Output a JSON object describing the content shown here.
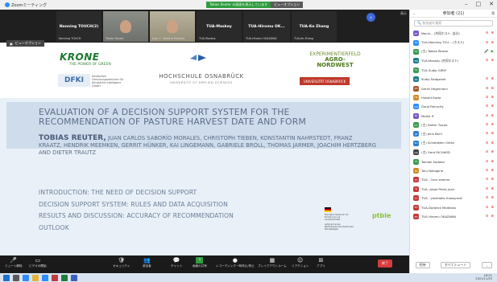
{
  "titlebar": {
    "app_title": "Zoomミーティング",
    "share_banner_green": "Tobias Reuter の画面を表示しています",
    "share_banner_gray": "ビューオプション"
  },
  "gallery": {
    "tiles": [
      {
        "name": "Nanning TOUCH(2)",
        "sub": "Nanning TOUCH"
      },
      {
        "name": "",
        "sub": "Tobias Reuter"
      },
      {
        "name": "",
        "sub": "Juan C. Saborío Morales"
      },
      {
        "name": "TUA-Maskey",
        "sub": "TUA-Maskey"
      },
      {
        "name": "TUA-Hiromu OK...",
        "sub": "TUA-Hiromu OKAZAWA"
      },
      {
        "name": "TUA-Ke Zhang",
        "sub": "TUA-Ke Zhang"
      }
    ],
    "view_label": "表示"
  },
  "share_label": "ビューオプション",
  "slide": {
    "krone": "KRONE",
    "krone_sub": "THE POWER OF GREEN",
    "hs_name": "HOCHSCHULE OSNABRÜCK",
    "hs_sub": "UNIVERSITY OF APPLIED SCIENCES",
    "dfki": "DFKI",
    "dfki_text": "Deutsches Forschungszentrum für Künstliche Intelligenz GmbH",
    "expf_line1": "EXPERIMENTIERFELD",
    "expf_line2": "AGRO-NORDWEST",
    "uni": "UNIVERSITÄT OSNABRÜCK",
    "title": "EVALUATION OF A DECISION SUPPORT SYSTEM FOR THE RECOMMENDATION OF PASTURE HARVEST DATE AND FORM",
    "author_lead": "TOBIAS REUTER,",
    "authors_rest": " JUAN CARLOS SABORÍO MORALES, CHRISTOPH TIEBEN, KONSTANTIN NAHRSTEDT, FRANZ KRAATZ, HENDRIK MEEMKEN, GERRIT HÜNKER, KAI LINGEMANN, GABRIELE BROLL, THOMAS JARMER, JOACHIM HERTZBERG AND DIETER TRAUTZ",
    "outline": [
      "INTRODUCTION: THE NEED OF DECISION SUPPORT",
      "DECISION SUPPORT SYSTEM: RULES AND DATA ACQUISITION",
      "RESULTS AND DISCUSSION: ACCURACY OF RECOMMENDATION",
      "OUTLOOK"
    ],
    "bm_text": "Bundesministerium für Ernährung und Landwirtschaft",
    "bm_sub": "aufgrund eines Beschlusses des Deutschen Bundestages",
    "ptble": "ptble"
  },
  "toolbar": {
    "items": [
      {
        "label": "ミュート解除",
        "icon": "🎤"
      },
      {
        "label": "ビデオの開始",
        "icon": "▭"
      },
      {
        "label": "セキュリティ",
        "icon": "🛡"
      },
      {
        "label": "参加者",
        "icon": "👥"
      },
      {
        "label": "チャット",
        "icon": "💬"
      },
      {
        "label": "画面の共有",
        "icon": "↑"
      },
      {
        "label": "レコーディング一時停止/停止",
        "icon": "●"
      },
      {
        "label": "ブレイクアウトルーム",
        "icon": "▦"
      },
      {
        "label": "リアクション",
        "icon": "☺"
      },
      {
        "label": "アプリ",
        "icon": "⊞"
      }
    ],
    "end_label": "終了"
  },
  "panel": {
    "title": "参加者 (21)",
    "search_placeholder": "🔍 参加者を検索",
    "participants": [
      {
        "name": "Nanni... (共同ホスト, 自分)",
        "initial": "NT",
        "color": "#7a57c9",
        "mic": "off",
        "cam": "off"
      },
      {
        "name": "TUA-Nanning TOU... (ホスト)",
        "initial": "TN",
        "color": "#2d8cff",
        "mic": "off",
        "cam": "off"
      },
      {
        "name": "(主) Tobias Reuter",
        "initial": "TR",
        "color": "#3a9a52",
        "mic": "on",
        "cam": "on"
      },
      {
        "name": "TUA-Maskey (共同ホスト)",
        "initial": "TM",
        "color": "#1f7d8c",
        "mic": "off",
        "cam": "off"
      },
      {
        "name": "TUA Sudip GIRM",
        "initial": "TS",
        "color": "#3a9a52",
        "mic": "none",
        "cam": "none"
      },
      {
        "name": "Sudip Sedgwine",
        "initial": "SS",
        "color": "#1f7d8c",
        "mic": "off",
        "cam": "off"
      },
      {
        "name": "Gerrit Hegemann",
        "initial": "GH",
        "color": "#a05a2c",
        "mic": "off",
        "cam": "off"
      },
      {
        "name": "Hubert Korte",
        "initial": "HK",
        "color": "#d18a2a",
        "mic": "off",
        "cam": "off"
      },
      {
        "name": "Goud Renucity",
        "initial": "GR",
        "color": "#2d8cff",
        "mic": "off",
        "cam": "off"
      },
      {
        "name": "Media iF",
        "initial": "MI",
        "color": "#7a57c9",
        "mic": "off",
        "cam": "off"
      },
      {
        "name": "(主) Dieter Trautz",
        "initial": "DT",
        "color": "#3a9a52",
        "mic": "off",
        "cam": "off"
      },
      {
        "name": "(主) Jens Berll",
        "initial": "JB",
        "color": "#2a7fd0",
        "mic": "off",
        "cam": "off"
      },
      {
        "name": "(主) Schiedelen Ulrike",
        "initial": "SU",
        "color": "#2a7fd0",
        "mic": "off",
        "cam": "off"
      },
      {
        "name": "(主) Gerd RICHARD",
        "initial": "GR",
        "color": "#444444",
        "mic": "off",
        "cam": "off"
      },
      {
        "name": "Tomoki Sadatoi",
        "initial": "TS",
        "color": "#3a9a52",
        "mic": "off",
        "cam": "off"
      },
      {
        "name": "Toru Nakagirie",
        "initial": "TN",
        "color": "#d18a2a",
        "mic": "off",
        "cam": "off"
      },
      {
        "name": "TUA - Cam zomme",
        "initial": "TC",
        "color": "#c23a3a",
        "mic": "off",
        "cam": "off"
      },
      {
        "name": "TUA -Jorge Perez Juan",
        "initial": "TJ",
        "color": "#c23a3a",
        "mic": "off",
        "cam": "off"
      },
      {
        "name": "TUA - yoshitake masayoshi",
        "initial": "TY",
        "color": "#c23a3a",
        "mic": "off",
        "cam": "off"
      },
      {
        "name": "TUA-Dorbeck Maddiolu",
        "initial": "TD",
        "color": "#c23a3a",
        "mic": "off",
        "cam": "off"
      },
      {
        "name": "TUA Hiromu OKAZAWA",
        "initial": "TH",
        "color": "#c23a3a",
        "mic": "off",
        "cam": "off"
      }
    ],
    "invite_label": "招待",
    "mute_all_label": "すべてミュート",
    "more_label": "..."
  },
  "tray": {
    "time": "16:51",
    "date": "2021/11/25"
  }
}
